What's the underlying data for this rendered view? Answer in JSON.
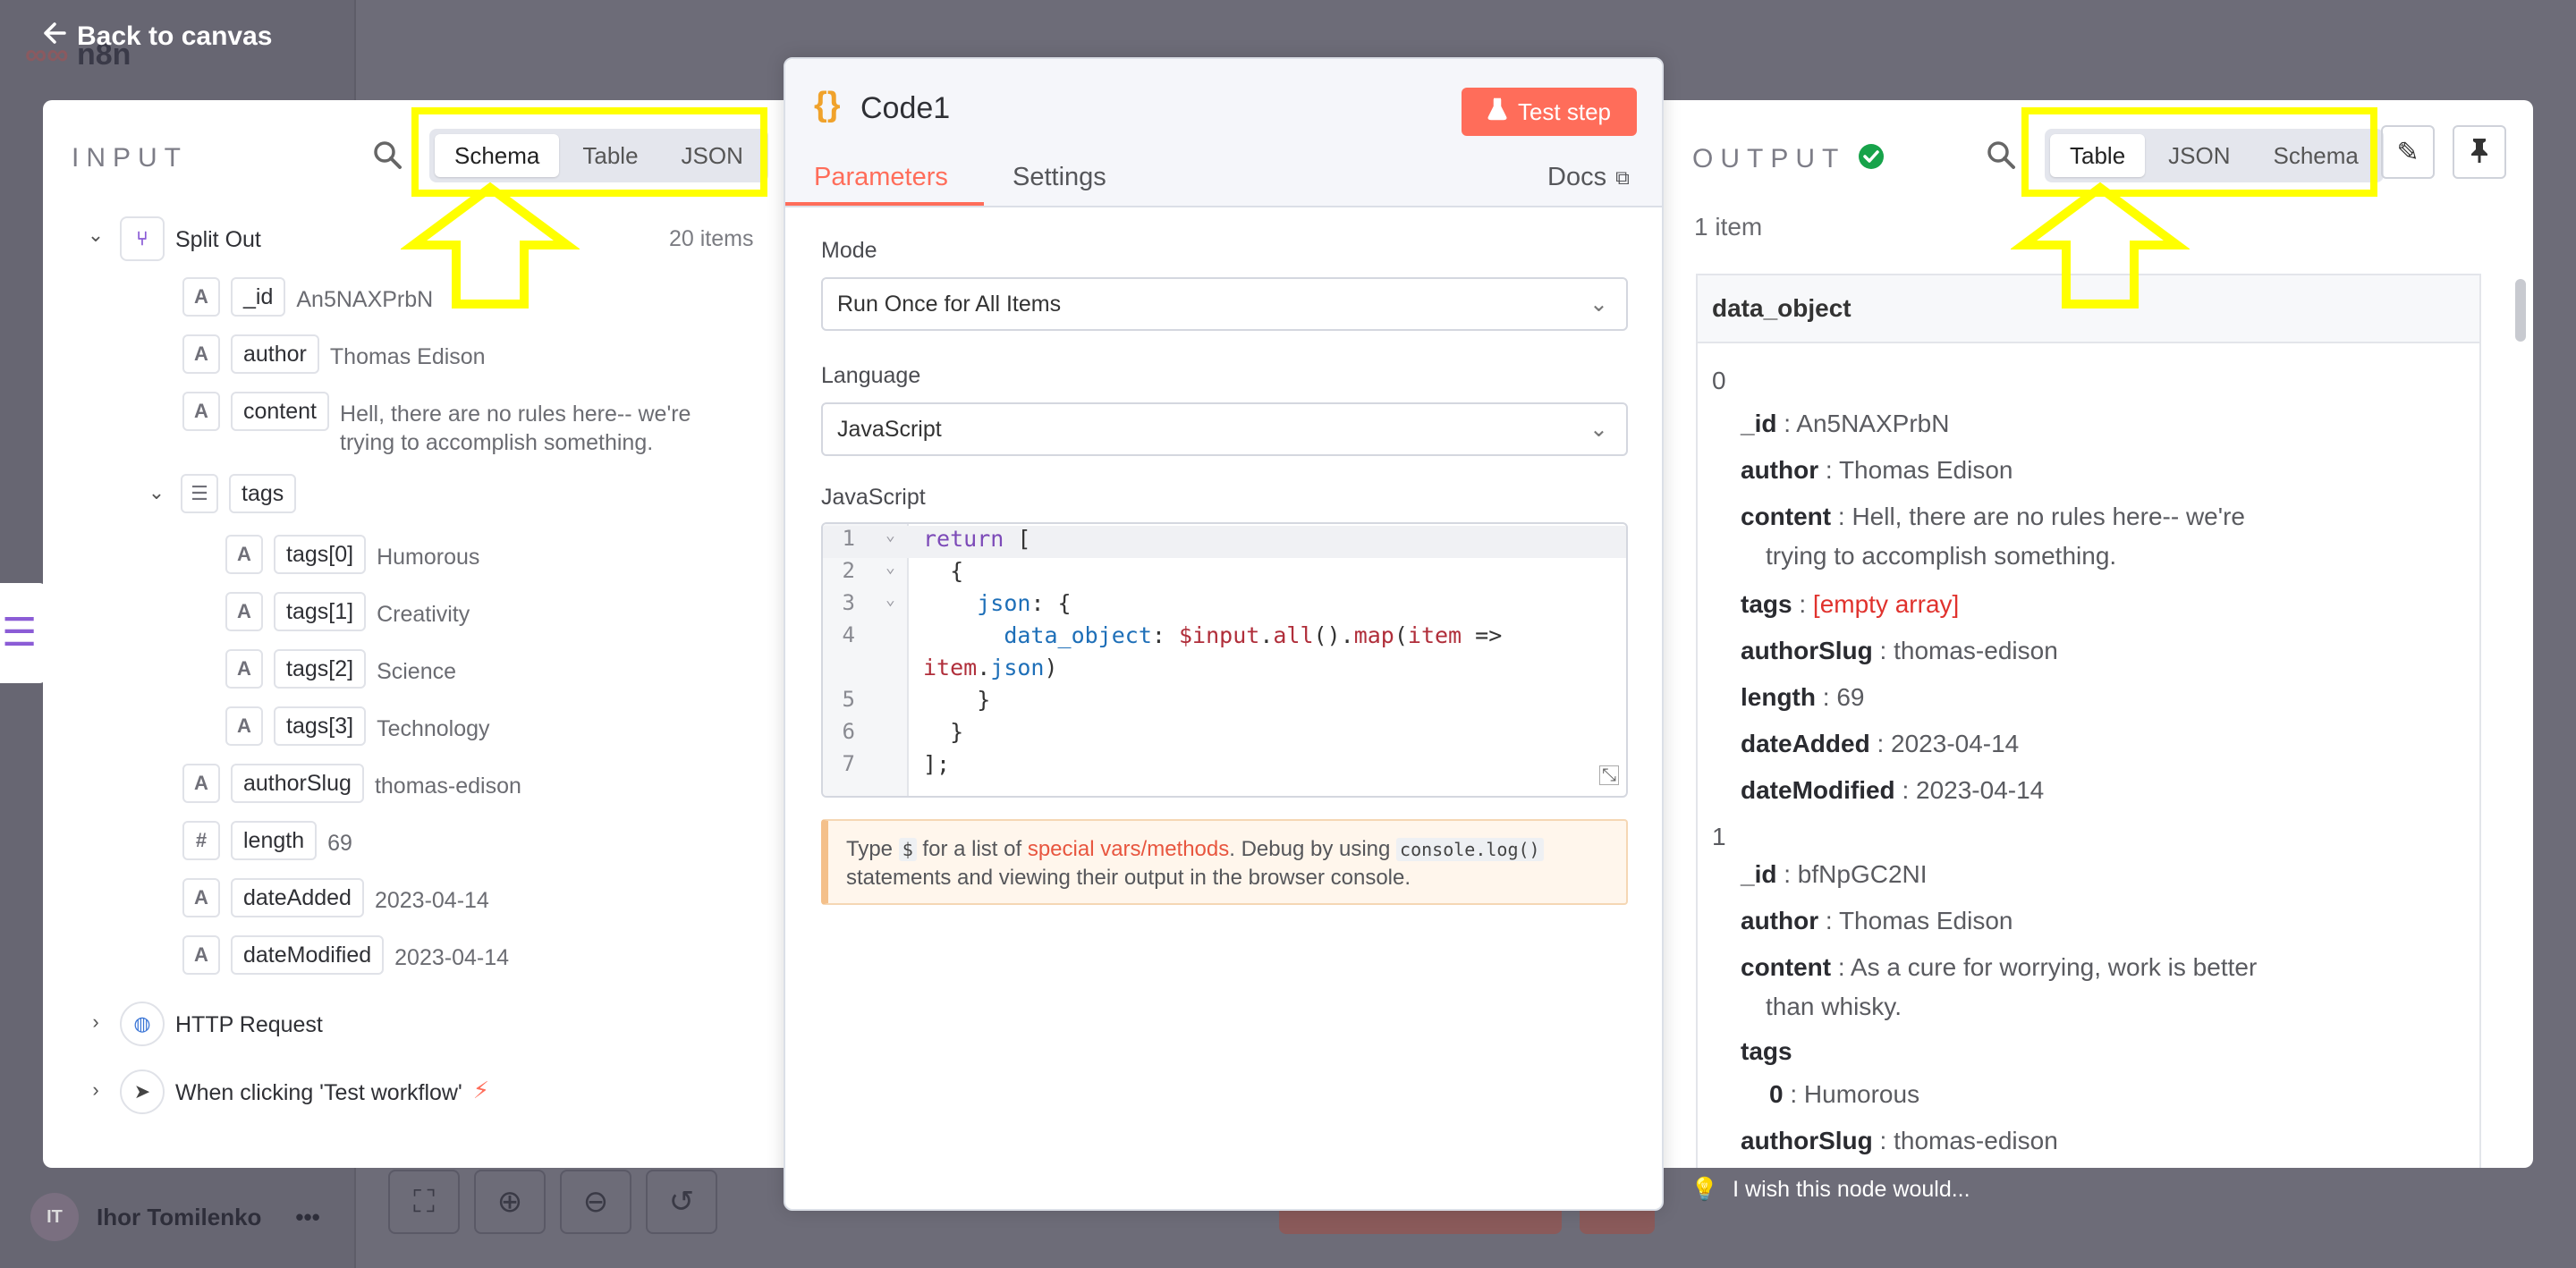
{
  "app": {
    "logo_text": "n8n",
    "back_label": "Back to canvas",
    "user_name": "Ihor Tomilenko",
    "user_initials": "IT",
    "wish_text": "I wish this node would..."
  },
  "input": {
    "title": "INPUT",
    "tabs": [
      "Schema",
      "Table",
      "JSON"
    ],
    "active_tab": "Schema",
    "node_name": "Split Out",
    "item_count": "20 items",
    "fields": [
      {
        "type": "A",
        "key": "_id",
        "value": "An5NAXPrbN"
      },
      {
        "type": "A",
        "key": "author",
        "value": "Thomas Edison"
      },
      {
        "type": "A",
        "key": "content",
        "value": "Hell, there are no rules here-- we're",
        "value2": "trying to accomplish something."
      },
      {
        "type": "list",
        "key": "tags"
      },
      {
        "type": "A",
        "key": "tags[0]",
        "value": "Humorous"
      },
      {
        "type": "A",
        "key": "tags[1]",
        "value": "Creativity"
      },
      {
        "type": "A",
        "key": "tags[2]",
        "value": "Science"
      },
      {
        "type": "A",
        "key": "tags[3]",
        "value": "Technology"
      },
      {
        "type": "A",
        "key": "authorSlug",
        "value": "thomas-edison"
      },
      {
        "type": "#",
        "key": "length",
        "value": "69"
      },
      {
        "type": "A",
        "key": "dateAdded",
        "value": "2023-04-14"
      },
      {
        "type": "A",
        "key": "dateModified",
        "value": "2023-04-14"
      }
    ],
    "other_nodes": [
      "HTTP Request",
      "When clicking 'Test workflow'"
    ]
  },
  "node": {
    "icon": "{}",
    "title": "Code1",
    "test_button": "Test step",
    "tabs": [
      "Parameters",
      "Settings"
    ],
    "docs_label": "Docs",
    "mode_label": "Mode",
    "mode_value": "Run Once for All Items",
    "language_label": "Language",
    "language_value": "JavaScript",
    "code_label": "JavaScript",
    "hint_pre": "Type",
    "hint_dollar": "$",
    "hint_mid": "for a list of",
    "hint_link": "special vars/methods",
    "hint_post": ". Debug by using",
    "hint_code": "console.log()",
    "hint_end": "statements and viewing their output in the browser console."
  },
  "output": {
    "title": "OUTPUT",
    "tabs": [
      "Table",
      "JSON",
      "Schema"
    ],
    "active_tab": "Table",
    "item_count": "1 item",
    "column_header": "data_object",
    "rows": {
      "idx0": "0",
      "r0_id_k": "_id",
      "r0_id_v": ": An5NAXPrbN",
      "r0_author_k": "author",
      "r0_author_v": ": Thomas Edison",
      "r0_content_k": "content",
      "r0_content_v": ": Hell, there are no rules here-- we're",
      "r0_content_v2": "trying to accomplish something.",
      "r0_tags_k": "tags",
      "r0_tags_sep": ":",
      "r0_tags_v": "[empty array]",
      "r0_slug_k": "authorSlug",
      "r0_slug_v": ": thomas-edison",
      "r0_len_k": "length",
      "r0_len_v": ": 69",
      "r0_da_k": "dateAdded",
      "r0_da_v": ": 2023-04-14",
      "r0_dm_k": "dateModified",
      "r0_dm_v": ": 2023-04-14",
      "idx1": "1",
      "r1_id_k": "_id",
      "r1_id_v": ": bfNpGC2NI",
      "r1_author_k": "author",
      "r1_author_v": ": Thomas Edison",
      "r1_content_k": "content",
      "r1_content_v": ": As a cure for worrying, work is better",
      "r1_content_v2": "than whisky.",
      "r1_tags_k": "tags",
      "r1_tag0_k": "0",
      "r1_tag0_v": ": Humorous",
      "r1_slug_k": "authorSlug",
      "r1_slug_v": ": thomas-edison"
    }
  },
  "colors": {
    "accent": "#ff6d5a",
    "highlight": "#ffff00",
    "success": "#17a34a"
  }
}
